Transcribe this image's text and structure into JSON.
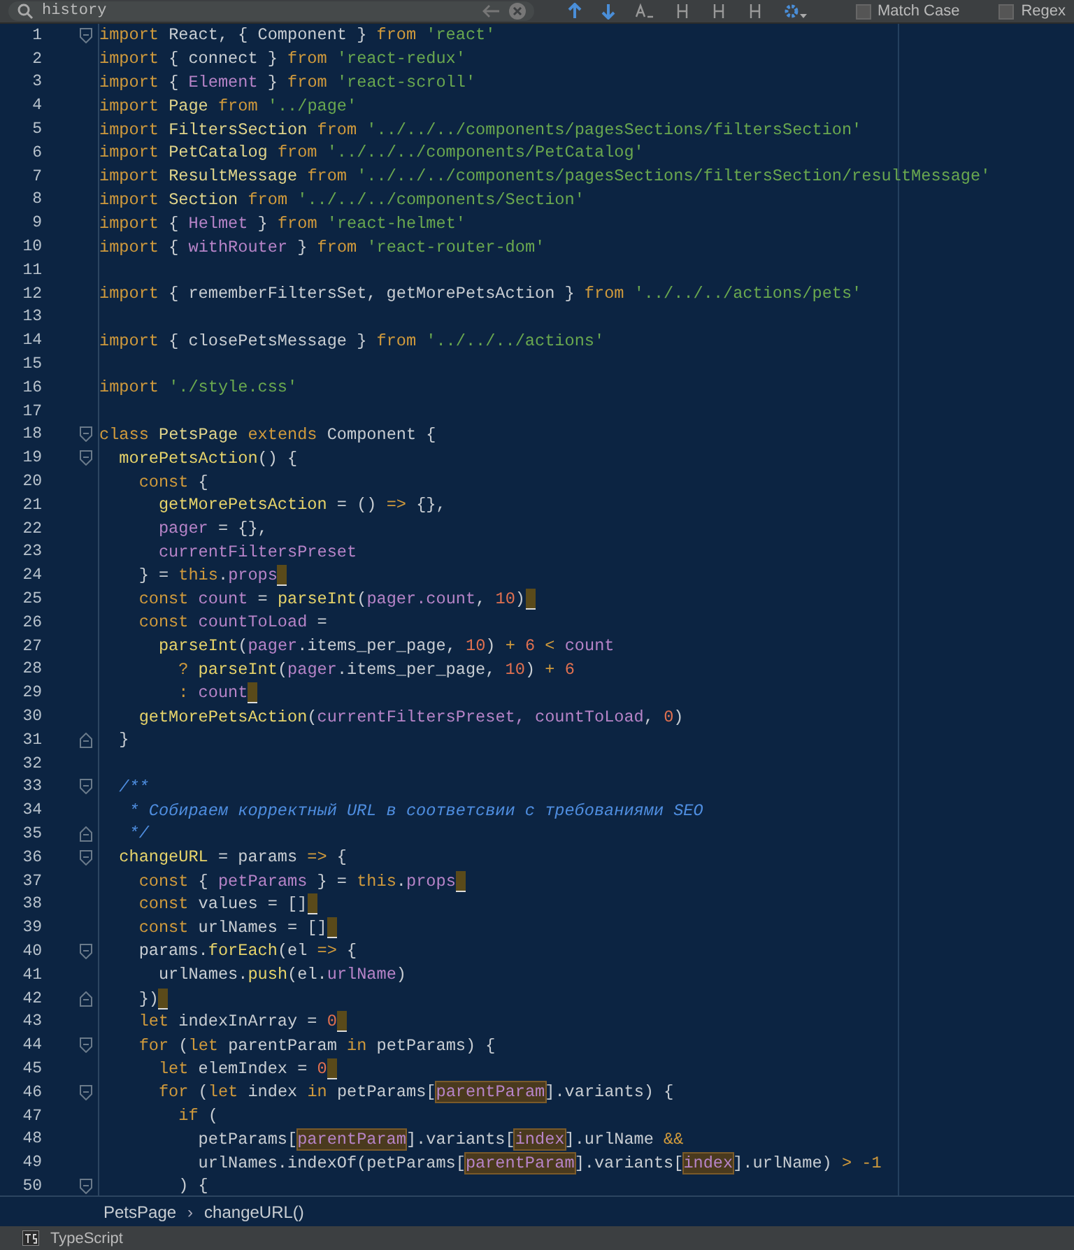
{
  "find_bar": {
    "search": {
      "value": "history"
    },
    "options": [
      {
        "label": "Match Case",
        "checked": false
      },
      {
        "label": "Regex",
        "checked": false
      }
    ]
  },
  "editor": {
    "lines": [
      {
        "number": "1",
        "fold_open": true,
        "fold_close": false,
        "end_mark": false,
        "tokens": [
          {
            "kind": "kw",
            "t": "import"
          },
          {
            "kind": "txt",
            "t": " React, { Component } "
          },
          {
            "kind": "kw",
            "t": "from"
          },
          {
            "kind": "str",
            "t": " 'react'"
          }
        ]
      },
      {
        "number": "2",
        "fold_open": false,
        "fold_close": false,
        "end_mark": false,
        "tokens": [
          {
            "kind": "kw",
            "t": "import"
          },
          {
            "kind": "txt",
            "t": " { connect } "
          },
          {
            "kind": "kw",
            "t": "from"
          },
          {
            "kind": "str",
            "t": " 'react-redux'"
          }
        ]
      },
      {
        "number": "3",
        "fold_open": false,
        "fold_close": false,
        "end_mark": false,
        "tokens": [
          {
            "kind": "kw",
            "t": "import"
          },
          {
            "kind": "txt",
            "t": " { "
          },
          {
            "kind": "prop",
            "t": "Element"
          },
          {
            "kind": "txt",
            "t": " } "
          },
          {
            "kind": "kw",
            "t": "from"
          },
          {
            "kind": "str",
            "t": " 'react-scroll'"
          }
        ]
      },
      {
        "number": "4",
        "fold_open": false,
        "fold_close": false,
        "end_mark": false,
        "tokens": [
          {
            "kind": "kw",
            "t": "import"
          },
          {
            "kind": "cls",
            "t": " Page "
          },
          {
            "kind": "kw",
            "t": "from"
          },
          {
            "kind": "str",
            "t": " '../page'"
          }
        ]
      },
      {
        "number": "5",
        "fold_open": false,
        "fold_close": false,
        "end_mark": false,
        "tokens": [
          {
            "kind": "kw",
            "t": "import"
          },
          {
            "kind": "cls",
            "t": " FiltersSection "
          },
          {
            "kind": "kw",
            "t": "from"
          },
          {
            "kind": "str",
            "t": " '../../../components/pagesSections/filtersSection'"
          }
        ]
      },
      {
        "number": "6",
        "fold_open": false,
        "fold_close": false,
        "end_mark": false,
        "tokens": [
          {
            "kind": "kw",
            "t": "import"
          },
          {
            "kind": "cls",
            "t": " PetCatalog "
          },
          {
            "kind": "kw",
            "t": "from"
          },
          {
            "kind": "str",
            "t": " '../../../components/PetCatalog'"
          }
        ]
      },
      {
        "number": "7",
        "fold_open": false,
        "fold_close": false,
        "end_mark": false,
        "tokens": [
          {
            "kind": "kw",
            "t": "import"
          },
          {
            "kind": "cls",
            "t": " ResultMessage "
          },
          {
            "kind": "kw",
            "t": "from"
          },
          {
            "kind": "str",
            "t": " '../../../components/pagesSections/filtersSection/resultMessage'"
          }
        ]
      },
      {
        "number": "8",
        "fold_open": false,
        "fold_close": false,
        "end_mark": false,
        "tokens": [
          {
            "kind": "kw",
            "t": "import"
          },
          {
            "kind": "cls",
            "t": " Section "
          },
          {
            "kind": "kw",
            "t": "from"
          },
          {
            "kind": "str",
            "t": " '../../../components/Section'"
          }
        ]
      },
      {
        "number": "9",
        "fold_open": false,
        "fold_close": false,
        "end_mark": false,
        "tokens": [
          {
            "kind": "kw",
            "t": "import"
          },
          {
            "kind": "txt",
            "t": " { "
          },
          {
            "kind": "prop",
            "t": "Helmet"
          },
          {
            "kind": "txt",
            "t": " } "
          },
          {
            "kind": "kw",
            "t": "from"
          },
          {
            "kind": "str",
            "t": " 'react-helmet'"
          }
        ]
      },
      {
        "number": "10",
        "fold_open": false,
        "fold_close": false,
        "end_mark": false,
        "tokens": [
          {
            "kind": "kw",
            "t": "import"
          },
          {
            "kind": "txt",
            "t": " { "
          },
          {
            "kind": "prop",
            "t": "withRouter"
          },
          {
            "kind": "txt",
            "t": " } "
          },
          {
            "kind": "kw",
            "t": "from"
          },
          {
            "kind": "str",
            "t": " 'react-router-dom'"
          }
        ]
      },
      {
        "number": "11",
        "fold_open": false,
        "fold_close": false,
        "end_mark": false
      },
      {
        "number": "12",
        "fold_open": false,
        "fold_close": false,
        "end_mark": false,
        "tokens": [
          {
            "kind": "kw",
            "t": "import"
          },
          {
            "kind": "txt",
            "t": " { rememberFiltersSet, getMorePetsAction } "
          },
          {
            "kind": "kw",
            "t": "from"
          },
          {
            "kind": "str",
            "t": " '../../../actions/pets'"
          }
        ]
      },
      {
        "number": "13",
        "fold_open": false,
        "fold_close": false,
        "end_mark": false
      },
      {
        "number": "14",
        "fold_open": false,
        "fold_close": false,
        "end_mark": false,
        "tokens": [
          {
            "kind": "kw",
            "t": "import"
          },
          {
            "kind": "txt",
            "t": " { closePetsMessage } "
          },
          {
            "kind": "kw",
            "t": "from"
          },
          {
            "kind": "str",
            "t": " '../../../actions'"
          }
        ]
      },
      {
        "number": "15",
        "fold_open": false,
        "fold_close": false,
        "end_mark": false
      },
      {
        "number": "16",
        "fold_open": false,
        "fold_close": false,
        "end_mark": false,
        "tokens": [
          {
            "kind": "kw",
            "t": "import"
          },
          {
            "kind": "str",
            "t": " './style.css'"
          }
        ]
      },
      {
        "number": "17",
        "fold_open": false,
        "fold_close": false,
        "end_mark": false
      },
      {
        "number": "18",
        "fold_open": true,
        "fold_close": false,
        "end_mark": false,
        "tokens": [
          {
            "kind": "kw",
            "t": "class"
          },
          {
            "kind": "cls",
            "t": " PetsPage "
          },
          {
            "kind": "kw",
            "t": "extends"
          },
          {
            "kind": "txt",
            "t": " Component {"
          }
        ]
      },
      {
        "number": "19",
        "fold_open": true,
        "fold_close": false,
        "end_mark": false,
        "tokens": [
          {
            "kind": "fn",
            "t": "  morePetsAction"
          },
          {
            "kind": "txt",
            "t": "() {"
          }
        ]
      },
      {
        "number": "20",
        "fold_open": false,
        "fold_close": false,
        "end_mark": false,
        "tokens": [
          {
            "kind": "kw",
            "t": "    const"
          },
          {
            "kind": "txt",
            "t": " {"
          }
        ]
      },
      {
        "number": "21",
        "fold_open": false,
        "fold_close": false,
        "end_mark": false,
        "tokens": [
          {
            "kind": "fn",
            "t": "      getMorePetsAction"
          },
          {
            "kind": "txt",
            "t": " = () "
          },
          {
            "kind": "kw",
            "t": "=>"
          },
          {
            "kind": "txt",
            "t": " {},"
          }
        ]
      },
      {
        "number": "22",
        "fold_open": false,
        "fold_close": false,
        "end_mark": false,
        "tokens": [
          {
            "kind": "prop",
            "t": "      pager"
          },
          {
            "kind": "txt",
            "t": " = {},"
          }
        ]
      },
      {
        "number": "23",
        "fold_open": false,
        "fold_close": false,
        "end_mark": false,
        "tokens": [
          {
            "kind": "prop",
            "t": "      currentFiltersPreset"
          }
        ]
      },
      {
        "number": "24",
        "fold_open": false,
        "fold_close": false,
        "end_mark": true,
        "tokens": [
          {
            "kind": "txt",
            "t": "    } = "
          },
          {
            "kind": "kw",
            "t": "this"
          },
          {
            "kind": "txt",
            "t": "."
          },
          {
            "kind": "prop",
            "t": "props"
          }
        ]
      },
      {
        "number": "25",
        "fold_open": false,
        "fold_close": false,
        "end_mark": true,
        "tokens": [
          {
            "kind": "kw",
            "t": "    const"
          },
          {
            "kind": "prop",
            "t": " count"
          },
          {
            "kind": "txt",
            "t": " = "
          },
          {
            "kind": "fn",
            "t": "parseInt"
          },
          {
            "kind": "txt",
            "t": "("
          },
          {
            "kind": "prop",
            "t": "pager.count"
          },
          {
            "kind": "txt",
            "t": ", "
          },
          {
            "kind": "num",
            "t": "10"
          },
          {
            "kind": "txt",
            "t": ")"
          }
        ]
      },
      {
        "number": "26",
        "fold_open": false,
        "fold_close": false,
        "end_mark": false,
        "tokens": [
          {
            "kind": "kw",
            "t": "    const"
          },
          {
            "kind": "prop",
            "t": " countToLoad"
          },
          {
            "kind": "txt",
            "t": " ="
          }
        ]
      },
      {
        "number": "27",
        "fold_open": false,
        "fold_close": false,
        "end_mark": false,
        "tokens": [
          {
            "kind": "fn",
            "t": "      parseInt"
          },
          {
            "kind": "txt",
            "t": "("
          },
          {
            "kind": "prop",
            "t": "pager"
          },
          {
            "kind": "txt",
            "t": ".items_per_page, "
          },
          {
            "kind": "num",
            "t": "10"
          },
          {
            "kind": "txt",
            "t": ") "
          },
          {
            "kind": "kw",
            "t": "+"
          },
          {
            "kind": "num",
            "t": " 6"
          },
          {
            "kind": "kw",
            "t": " <"
          },
          {
            "kind": "prop",
            "t": " count"
          }
        ]
      },
      {
        "number": "28",
        "fold_open": false,
        "fold_close": false,
        "end_mark": false,
        "tokens": [
          {
            "kind": "kw",
            "t": "        ?"
          },
          {
            "kind": "fn",
            "t": " parseInt"
          },
          {
            "kind": "txt",
            "t": "("
          },
          {
            "kind": "prop",
            "t": "pager"
          },
          {
            "kind": "txt",
            "t": ".items_per_page, "
          },
          {
            "kind": "num",
            "t": "10"
          },
          {
            "kind": "txt",
            "t": ") "
          },
          {
            "kind": "kw",
            "t": "+"
          },
          {
            "kind": "num",
            "t": " 6"
          }
        ]
      },
      {
        "number": "29",
        "fold_open": false,
        "fold_close": false,
        "end_mark": true,
        "tokens": [
          {
            "kind": "kw",
            "t": "        :"
          },
          {
            "kind": "prop",
            "t": " count"
          }
        ]
      },
      {
        "number": "30",
        "fold_open": false,
        "fold_close": false,
        "end_mark": false,
        "tokens": [
          {
            "kind": "fn",
            "t": "    getMorePetsAction"
          },
          {
            "kind": "txt",
            "t": "("
          },
          {
            "kind": "prop",
            "t": "currentFiltersPreset, countToLoad"
          },
          {
            "kind": "txt",
            "t": ", "
          },
          {
            "kind": "num",
            "t": "0"
          },
          {
            "kind": "txt",
            "t": ")"
          }
        ]
      },
      {
        "number": "31",
        "fold_open": false,
        "fold_close": true,
        "end_mark": false,
        "tokens": [
          {
            "kind": "txt",
            "t": "  }"
          }
        ]
      },
      {
        "number": "32",
        "fold_open": false,
        "fold_close": false,
        "end_mark": false
      },
      {
        "number": "33",
        "fold_open": true,
        "fold_close": false,
        "end_mark": false,
        "tokens": [
          {
            "kind": "cmt",
            "t": "  /**"
          }
        ]
      },
      {
        "number": "34",
        "fold_open": false,
        "fold_close": false,
        "end_mark": false,
        "tokens": [
          {
            "kind": "cmt",
            "t": "   * Собираем корректный URL в соответсвии с требованиями SEO"
          }
        ]
      },
      {
        "number": "35",
        "fold_open": false,
        "fold_close": true,
        "end_mark": false,
        "tokens": [
          {
            "kind": "cmt",
            "t": "   */"
          }
        ]
      },
      {
        "number": "36",
        "fold_open": true,
        "fold_close": false,
        "end_mark": false,
        "tokens": [
          {
            "kind": "fn",
            "t": "  changeURL"
          },
          {
            "kind": "txt",
            "t": " = params "
          },
          {
            "kind": "kw",
            "t": "=>"
          },
          {
            "kind": "txt",
            "t": " {"
          }
        ]
      },
      {
        "number": "37",
        "fold_open": false,
        "fold_close": false,
        "end_mark": true,
        "tokens": [
          {
            "kind": "kw",
            "t": "    const"
          },
          {
            "kind": "txt",
            "t": " { "
          },
          {
            "kind": "prop",
            "t": "petParams"
          },
          {
            "kind": "txt",
            "t": " } = "
          },
          {
            "kind": "kw",
            "t": "this"
          },
          {
            "kind": "txt",
            "t": "."
          },
          {
            "kind": "prop",
            "t": "props"
          }
        ]
      },
      {
        "number": "38",
        "fold_open": false,
        "fold_close": false,
        "end_mark": true,
        "tokens": [
          {
            "kind": "kw",
            "t": "    const"
          },
          {
            "kind": "txt",
            "t": " values = []"
          }
        ]
      },
      {
        "number": "39",
        "fold_open": false,
        "fold_close": false,
        "end_mark": true,
        "tokens": [
          {
            "kind": "kw",
            "t": "    const"
          },
          {
            "kind": "txt",
            "t": " urlNames = []"
          }
        ]
      },
      {
        "number": "40",
        "fold_open": true,
        "fold_close": false,
        "end_mark": false,
        "tokens": [
          {
            "kind": "txt",
            "t": "    params."
          },
          {
            "kind": "fn",
            "t": "forEach"
          },
          {
            "kind": "txt",
            "t": "(el "
          },
          {
            "kind": "kw",
            "t": "=>"
          },
          {
            "kind": "txt",
            "t": " {"
          }
        ]
      },
      {
        "number": "41",
        "fold_open": false,
        "fold_close": false,
        "end_mark": false,
        "tokens": [
          {
            "kind": "txt",
            "t": "      urlNames."
          },
          {
            "kind": "fn",
            "t": "push"
          },
          {
            "kind": "txt",
            "t": "(el."
          },
          {
            "kind": "prop",
            "t": "urlName"
          },
          {
            "kind": "txt",
            "t": ")"
          }
        ]
      },
      {
        "number": "42",
        "fold_open": false,
        "fold_close": true,
        "end_mark": true,
        "tokens": [
          {
            "kind": "txt",
            "t": "    })"
          }
        ]
      },
      {
        "number": "43",
        "fold_open": false,
        "fold_close": false,
        "end_mark": true,
        "tokens": [
          {
            "kind": "kw",
            "t": "    let"
          },
          {
            "kind": "txt",
            "t": " indexInArray = "
          },
          {
            "kind": "num",
            "t": "0"
          }
        ]
      },
      {
        "number": "44",
        "fold_open": true,
        "fold_close": false,
        "end_mark": false,
        "tokens": [
          {
            "kind": "kw",
            "t": "    for"
          },
          {
            "kind": "txt",
            "t": " ("
          },
          {
            "kind": "kw",
            "t": "let"
          },
          {
            "kind": "txt",
            "t": " parentParam "
          },
          {
            "kind": "kw",
            "t": "in"
          },
          {
            "kind": "txt",
            "t": " petParams) {"
          }
        ]
      },
      {
        "number": "45",
        "fold_open": false,
        "fold_close": false,
        "end_mark": true,
        "tokens": [
          {
            "kind": "kw",
            "t": "      let"
          },
          {
            "kind": "txt",
            "t": " elemIndex = "
          },
          {
            "kind": "num",
            "t": "0"
          }
        ]
      },
      {
        "number": "46",
        "fold_open": true,
        "fold_close": false,
        "end_mark": false,
        "tokens": [
          {
            "kind": "kw",
            "t": "      for"
          },
          {
            "kind": "txt",
            "t": " ("
          },
          {
            "kind": "kw",
            "t": "let"
          },
          {
            "kind": "txt",
            "t": " index "
          },
          {
            "kind": "kw",
            "t": "in"
          },
          {
            "kind": "txt",
            "t": " petParams["
          },
          {
            "kind": "hl",
            "t": "parentParam"
          },
          {
            "kind": "txt",
            "t": "].variants) {"
          }
        ]
      },
      {
        "number": "47",
        "fold_open": false,
        "fold_close": false,
        "end_mark": false,
        "tokens": [
          {
            "kind": "kw",
            "t": "        if"
          },
          {
            "kind": "txt",
            "t": " ("
          }
        ]
      },
      {
        "number": "48",
        "fold_open": false,
        "fold_close": false,
        "end_mark": false,
        "tokens": [
          {
            "kind": "txt",
            "t": "          petParams["
          },
          {
            "kind": "hl",
            "t": "parentParam"
          },
          {
            "kind": "txt",
            "t": "].variants["
          },
          {
            "kind": "hl",
            "t": "index"
          },
          {
            "kind": "txt",
            "t": "].urlName "
          },
          {
            "kind": "kw",
            "t": "&&"
          }
        ]
      },
      {
        "number": "49",
        "fold_open": false,
        "fold_close": false,
        "end_mark": false,
        "tokens": [
          {
            "kind": "txt",
            "t": "          urlNames.indexOf(petParams["
          },
          {
            "kind": "hl",
            "t": "parentParam"
          },
          {
            "kind": "txt",
            "t": "].variants["
          },
          {
            "kind": "hl",
            "t": "index"
          },
          {
            "kind": "txt",
            "t": "].urlName) "
          },
          {
            "kind": "kw",
            "t": "> -1"
          }
        ]
      },
      {
        "number": "50",
        "fold_open": true,
        "fold_close": false,
        "end_mark": false,
        "tokens": [
          {
            "kind": "txt",
            "t": "        ) {"
          }
        ]
      }
    ]
  },
  "breadcrumb": [
    "PetsPage",
    "›",
    "changeURL()"
  ],
  "status_bar": {
    "language": "TypeScript"
  }
}
